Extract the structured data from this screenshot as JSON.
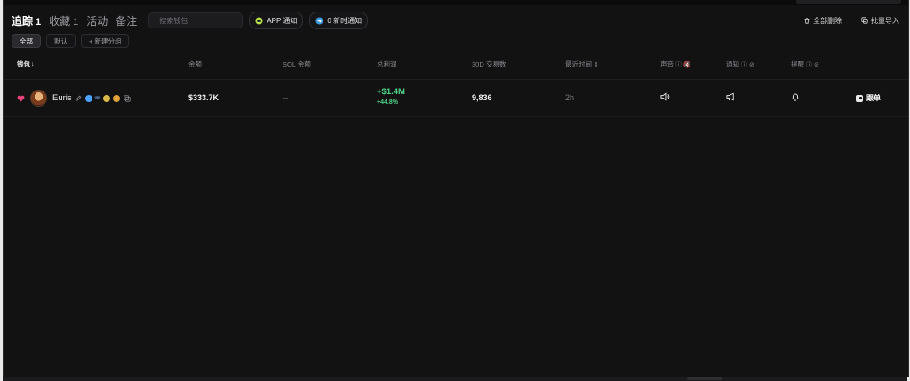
{
  "tabs": [
    {
      "label": "追踪",
      "count": "1",
      "active": true
    },
    {
      "label": "收藏",
      "count": "1",
      "active": false
    },
    {
      "label": "活动",
      "count": "",
      "active": false
    },
    {
      "label": "备注",
      "count": "",
      "active": false
    }
  ],
  "search": {
    "placeholder": "搜索钱包"
  },
  "notify": {
    "app_label": "APP 通知",
    "tg_label": "0 新时通知"
  },
  "actions": {
    "delete_all": "全部删除",
    "bulk_import": "批量导入"
  },
  "groups": {
    "all": "全部",
    "default": "默认",
    "new_group": "+ 新建分组"
  },
  "columns": {
    "wallet": "钱包",
    "balance": "余额",
    "sol_balance": "SOL 余额",
    "total_profit": "总利润",
    "trades_30d": "30D 交易数",
    "last_time": "最近时间",
    "sound": "声音",
    "notify": "通知",
    "remind": "提醒"
  },
  "rows": [
    {
      "name": "Euris",
      "balance": "$333.7K",
      "sol_balance": "--",
      "profit": "+$1.4M",
      "profit_pct": "+44.8%",
      "trades_30d": "9,836",
      "last_time": "2h",
      "follow_label": "跟单"
    }
  ],
  "colors": {
    "background": "#121213",
    "positive": "#4fd38a",
    "heart": "#e8437b"
  }
}
